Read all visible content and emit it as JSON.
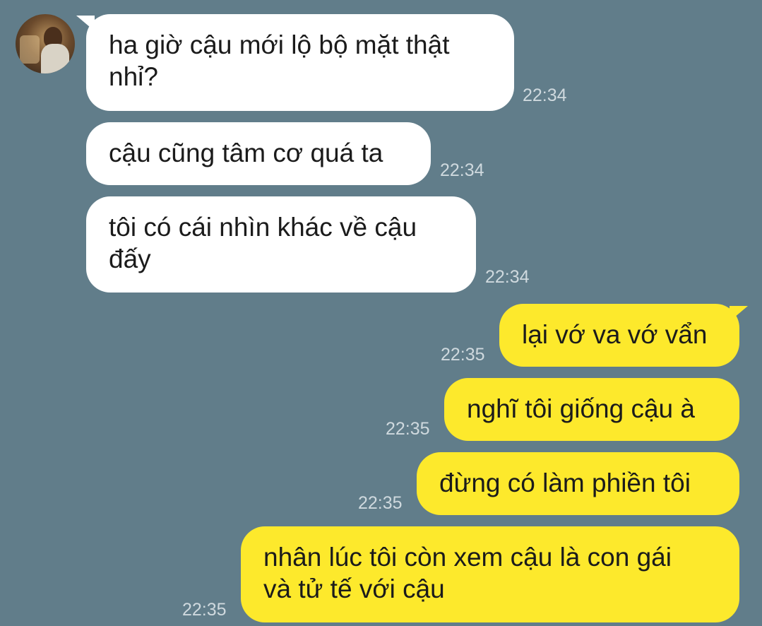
{
  "messages": [
    {
      "side": "in",
      "text": "ha giờ cậu mới lộ bộ mặt thật\nnhỉ?",
      "time": "22:34"
    },
    {
      "side": "in",
      "text": "cậu cũng tâm cơ quá ta",
      "time": "22:34"
    },
    {
      "side": "in",
      "text": "tôi có cái nhìn khác về cậu\nđấy",
      "time": "22:34"
    },
    {
      "side": "out",
      "text": "lại vớ va vớ vẩn",
      "time": "22:35"
    },
    {
      "side": "out",
      "text": "nghĩ tôi giống cậu à",
      "time": "22:35"
    },
    {
      "side": "out",
      "text": "đừng có làm phiền tôi",
      "time": "22:35"
    },
    {
      "side": "out",
      "text": "nhân lúc tôi còn xem cậu là con gái\nvà tử tế với cậu",
      "time": "22:35"
    }
  ],
  "colors": {
    "background": "#617d8a",
    "incoming_bubble": "#ffffff",
    "outgoing_bubble": "#fde92c",
    "timestamp": "#cfd9de"
  },
  "icons": {
    "avatar": "contact-avatar-photo"
  }
}
